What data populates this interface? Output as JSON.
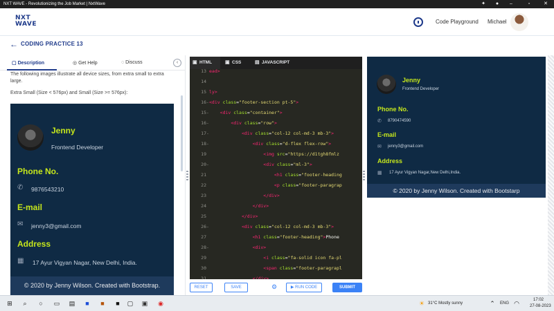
{
  "window": {
    "title": "NXT WAVE - Revolutionizing the Job Market | NxtWave"
  },
  "header": {
    "logo_line1": "NXT",
    "logo_line2": "WAVE",
    "playground": "Code Playground",
    "user": "Michael"
  },
  "practice": {
    "title": "CODING PRACTICE 13"
  },
  "left": {
    "tabs": [
      "Description",
      "Get Help",
      "Discuss"
    ],
    "desc1": "The following images illustrate all device sizes, from extra small to extra large.",
    "desc2": "Extra Small (Size < 576px) and Small (Size >= 576px):"
  },
  "profile": {
    "name": "Jenny",
    "role": "Frontend Developer",
    "phone_heading": "Phone No.",
    "email_heading": "E-mail",
    "address_heading": "Address"
  },
  "preview_left": {
    "phone": "9876543210",
    "email": "jenny3@gmail.com",
    "address": "17 Ayur Vigyan Nagar, New Delhi, India.",
    "footer": "© 2020 by Jenny Wilson. Created with Bootstrap."
  },
  "preview_right": {
    "phone": "8790474590",
    "email": "jenny3@gmail.com",
    "address": "17 Ayur Vigyan Nagar,New Delhi,India.",
    "footer": "© 2020 by Jenny Wilson. Created with Bootstarp"
  },
  "editor": {
    "tabs": [
      "HTML",
      "CSS",
      "JAVASCRIPT"
    ],
    "lines": [
      {
        "n": "13",
        "f": "",
        "parts": [
          [
            "kw",
            "ead>"
          ]
        ]
      },
      {
        "n": "14",
        "f": "",
        "parts": []
      },
      {
        "n": "15",
        "f": "",
        "parts": [
          [
            "kw",
            "ly>"
          ]
        ]
      },
      {
        "n": "16",
        "f": "-",
        "parts": [
          [
            "kw",
            "<div "
          ],
          [
            "at",
            "class"
          ],
          [
            "p",
            "="
          ],
          [
            "st",
            "\"footer-section pt-5\""
          ],
          [
            "kw",
            ">"
          ]
        ]
      },
      {
        "n": "15",
        "f": "-",
        "parts": [
          [
            "p",
            "    "
          ],
          [
            "kw",
            "<div "
          ],
          [
            "at",
            "class"
          ],
          [
            "p",
            "="
          ],
          [
            "st",
            "\"container\""
          ],
          [
            "kw",
            ">"
          ]
        ]
      },
      {
        "n": "16",
        "f": "-",
        "parts": [
          [
            "p",
            "        "
          ],
          [
            "kw",
            "<div "
          ],
          [
            "at",
            "class"
          ],
          [
            "p",
            "="
          ],
          [
            "st",
            "\"row\""
          ],
          [
            "kw",
            ">"
          ]
        ]
      },
      {
        "n": "17",
        "f": "-",
        "parts": [
          [
            "p",
            "            "
          ],
          [
            "kw",
            "<div "
          ],
          [
            "at",
            "class"
          ],
          [
            "p",
            "="
          ],
          [
            "st",
            "\"col-12 col-md-3 mb-3\""
          ],
          [
            "kw",
            ">"
          ]
        ]
      },
      {
        "n": "18",
        "f": "-",
        "parts": [
          [
            "p",
            "                "
          ],
          [
            "kw",
            "<div "
          ],
          [
            "at",
            "class"
          ],
          [
            "p",
            "="
          ],
          [
            "st",
            "\"d-flex flex-row\""
          ],
          [
            "kw",
            ">"
          ]
        ]
      },
      {
        "n": "19",
        "f": "",
        "parts": [
          [
            "p",
            "                    "
          ],
          [
            "kw",
            "<img "
          ],
          [
            "at",
            "src"
          ],
          [
            "p",
            "="
          ],
          [
            "st",
            "\"https://d1tgh8fmlz"
          ]
        ]
      },
      {
        "n": "20",
        "f": "-",
        "parts": [
          [
            "p",
            "                    "
          ],
          [
            "kw",
            "<div "
          ],
          [
            "at",
            "class"
          ],
          [
            "p",
            "="
          ],
          [
            "st",
            "\"ml-3\""
          ],
          [
            "kw",
            ">"
          ]
        ]
      },
      {
        "n": "21",
        "f": "",
        "parts": [
          [
            "p",
            "                        "
          ],
          [
            "kw",
            "<h1 "
          ],
          [
            "at",
            "class"
          ],
          [
            "p",
            "="
          ],
          [
            "st",
            "\"footer-heading"
          ]
        ]
      },
      {
        "n": "22",
        "f": "",
        "parts": [
          [
            "p",
            "                        "
          ],
          [
            "kw",
            "<p "
          ],
          [
            "at",
            "class"
          ],
          [
            "p",
            "="
          ],
          [
            "st",
            "\"footer-paragrap"
          ]
        ]
      },
      {
        "n": "23",
        "f": "",
        "parts": [
          [
            "p",
            "                    "
          ],
          [
            "kw",
            "</div>"
          ]
        ]
      },
      {
        "n": "24",
        "f": "",
        "parts": [
          [
            "p",
            "                "
          ],
          [
            "kw",
            "</div>"
          ]
        ]
      },
      {
        "n": "25",
        "f": "",
        "parts": [
          [
            "p",
            "            "
          ],
          [
            "kw",
            "</div>"
          ]
        ]
      },
      {
        "n": "26",
        "f": "-",
        "parts": [
          [
            "p",
            "            "
          ],
          [
            "kw",
            "<div "
          ],
          [
            "at",
            "class"
          ],
          [
            "p",
            "="
          ],
          [
            "st",
            "\"col-12 col-md-3 mb-3\""
          ],
          [
            "kw",
            ">"
          ]
        ]
      },
      {
        "n": "27",
        "f": "",
        "parts": [
          [
            "p",
            "                "
          ],
          [
            "kw",
            "<h1 "
          ],
          [
            "at",
            "class"
          ],
          [
            "p",
            "="
          ],
          [
            "st",
            "\"footer-heading\""
          ],
          [
            "kw",
            ">"
          ],
          [
            "p",
            "Phone"
          ]
        ]
      },
      {
        "n": "28",
        "f": "-",
        "parts": [
          [
            "p",
            "                "
          ],
          [
            "kw",
            "<div>"
          ]
        ]
      },
      {
        "n": "29",
        "f": "",
        "parts": [
          [
            "p",
            "                    "
          ],
          [
            "kw",
            "<i "
          ],
          [
            "at",
            "class"
          ],
          [
            "p",
            "="
          ],
          [
            "st",
            "\"fa-solid icon fa-pl"
          ]
        ]
      },
      {
        "n": "30",
        "f": "",
        "parts": [
          [
            "p",
            "                    "
          ],
          [
            "kw",
            "<span "
          ],
          [
            "at",
            "class"
          ],
          [
            "p",
            "="
          ],
          [
            "st",
            "\"footer-paragrapl"
          ]
        ]
      },
      {
        "n": "31",
        "f": "",
        "parts": [
          [
            "p",
            "                "
          ],
          [
            "kw",
            "</div>"
          ]
        ]
      }
    ],
    "reset": "RESET",
    "save": "SAVE",
    "run": "▶ RUN CODE",
    "submit": "SUBMIT"
  },
  "taskbar": {
    "weather": "31°C  Mostly sunny",
    "lang": "ENG",
    "time": "17:02",
    "date": "27-08-2023"
  },
  "colors": {
    "brand": "#1e3a8a",
    "accent_lime": "#c5e61c",
    "preview_bg": "#0f2a44",
    "button_blue": "#3b82f6"
  }
}
